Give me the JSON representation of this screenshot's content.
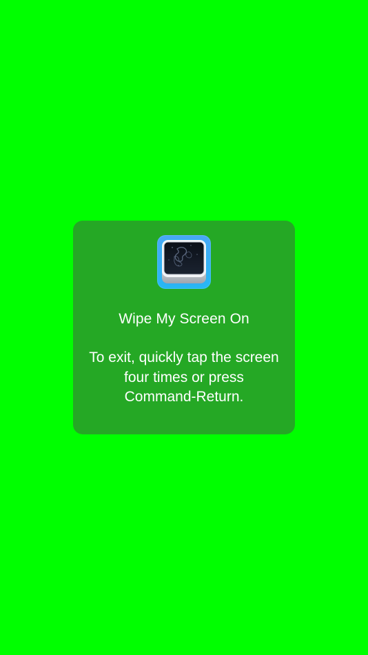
{
  "screen": {
    "background_color": "#00ff00"
  },
  "overlay": {
    "background_color": "#25a825",
    "icon_name": "wipe-my-screen-app-icon",
    "title": "Wipe My Screen On",
    "message": "To exit, quickly tap the screen four times or press Command-Return."
  }
}
